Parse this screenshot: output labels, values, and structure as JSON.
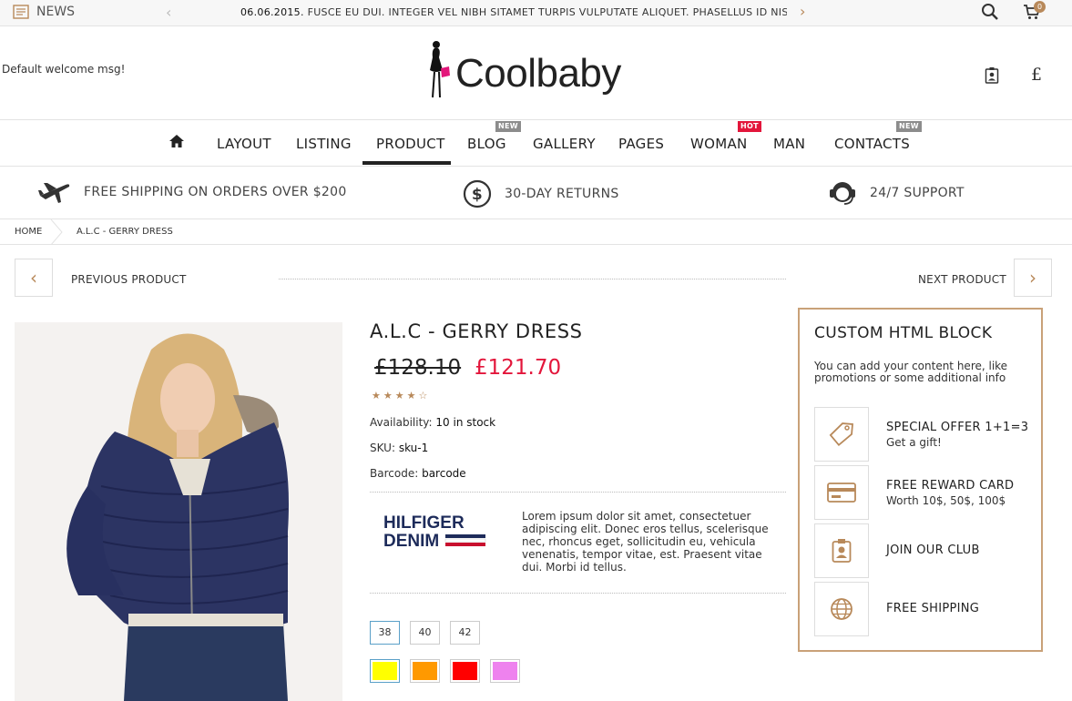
{
  "newsbar": {
    "label": "NEWS",
    "date": "06.06.2015.",
    "text": "FUSCE EU DUI. INTEGER VEL NIBH SITAMET TURPIS VULPUTATE ALIQUET. PHASELLUS ID NISI VI",
    "cart_count": "0"
  },
  "header": {
    "welcome": "Default welcome msg!",
    "logo": "Coolbaby",
    "currency": "£"
  },
  "nav": {
    "items": [
      {
        "label": "LAYOUT"
      },
      {
        "label": "LISTING"
      },
      {
        "label": "PRODUCT"
      },
      {
        "label": "BLOG",
        "badge": "NEW"
      },
      {
        "label": "GALLERY"
      },
      {
        "label": "PAGES"
      },
      {
        "label": "WOMAN",
        "badge": "HOT"
      },
      {
        "label": "MAN"
      },
      {
        "label": "CONTACTS",
        "badge": "NEW"
      }
    ]
  },
  "features": [
    {
      "label": "FREE SHIPPING ON ORDERS OVER $200",
      "icon": "plane-icon"
    },
    {
      "label": "30-DAY RETURNS",
      "icon": "dollar-icon"
    },
    {
      "label": "24/7 SUPPORT",
      "icon": "headset-icon"
    }
  ],
  "breadcrumb": {
    "home": "HOME",
    "current": "A.L.C - GERRY DRESS"
  },
  "pager": {
    "prev": "PREVIOUS PRODUCT",
    "next": "NEXT PRODUCT"
  },
  "product": {
    "title": "A.L.C - GERRY DRESS",
    "old_price": "£128.10",
    "price": "£121.70",
    "rating": 4,
    "rating_max": 5,
    "stars": "★★★★☆",
    "availability_label": "Availability:",
    "availability": "10 in stock",
    "sku_label": "SKU:",
    "sku": "sku-1",
    "barcode_label": "Barcode:",
    "barcode": "barcode",
    "brand_line1": "HILFIGER",
    "brand_line2": "DENIM",
    "brand_desc": "Lorem ipsum dolor sit amet, consectetuer adipiscing elit. Donec eros tellus, scelerisque nec, rhoncus eget, sollicitudin eu, vehicula venenatis, tempor vitae, est. Praesent vitae dui. Morbi id tellus.",
    "sizes": [
      "38",
      "40",
      "42"
    ],
    "colors": [
      "#ffff00",
      "#ff9900",
      "#ff0000",
      "#ee82ee"
    ]
  },
  "custom_block": {
    "title": "CUSTOM HTML BLOCK",
    "desc": "You can add your content here, like promotions or some additional info",
    "items": [
      {
        "label": "SPECIAL OFFER 1+1=3",
        "sub": "Get a gift!",
        "icon": "tag-icon"
      },
      {
        "label": "FREE REWARD CARD",
        "sub": "Worth 10$, 50$, 100$",
        "icon": "card-icon"
      },
      {
        "label": "JOIN OUR CLUB",
        "sub": "",
        "icon": "badge-icon"
      },
      {
        "label": "FREE SHIPPING",
        "sub": "",
        "icon": "globe-icon"
      }
    ]
  },
  "colors": {
    "accent": "#b8895a",
    "sale": "#e3163b",
    "border_accent": "#c9a178"
  }
}
